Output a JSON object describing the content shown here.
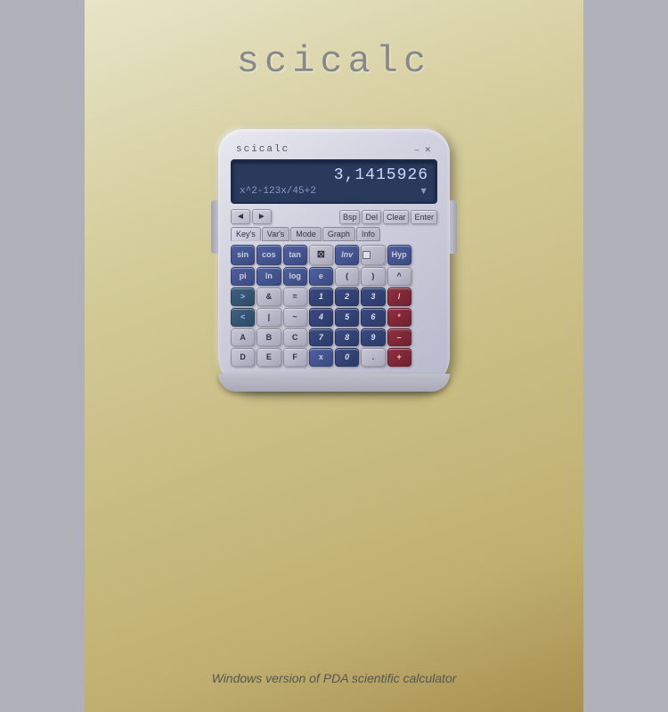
{
  "app": {
    "title": "scicalc",
    "subtitle": "Windows version of PDA scientific calculator"
  },
  "titlebar": {
    "label": "scicalc",
    "min_btn": "–",
    "close_btn": "✕"
  },
  "display": {
    "value": "3,1415926",
    "expression": "x^2-123x/45+2",
    "dropdown_arrow": "▼"
  },
  "controls": {
    "back_arrow": "◄",
    "fwd_arrow": "►",
    "bsp": "Bsp",
    "del": "Del",
    "clear": "Clear",
    "enter": "Enter"
  },
  "tabs": [
    {
      "label": "Key's",
      "active": true
    },
    {
      "label": "Var's",
      "active": false
    },
    {
      "label": "Mode",
      "active": false
    },
    {
      "label": "Graph",
      "active": false
    },
    {
      "label": "Info",
      "active": false
    }
  ],
  "rows": [
    [
      "sin",
      "cos",
      "tan",
      "✕",
      "Inv",
      "☐",
      "Hyp",
      ""
    ],
    [
      "pi",
      "ln",
      "log",
      "e",
      "(",
      ")",
      "^",
      ""
    ],
    [
      ">",
      "&",
      "=",
      "1",
      "2",
      "3",
      "/",
      ""
    ],
    [
      "<",
      "|",
      "~",
      "4",
      "5",
      "6",
      "*",
      ""
    ],
    [
      "A",
      "B",
      "C",
      "7",
      "8",
      "9",
      "–",
      ""
    ],
    [
      "D",
      "E",
      "F",
      "x",
      "0",
      ".",
      "+",
      ""
    ]
  ],
  "row_types": [
    [
      "btn-blue",
      "btn-blue",
      "btn-blue",
      "btn-gray",
      "btn-blue",
      "cb",
      "btn-blue",
      ""
    ],
    [
      "btn-blue",
      "btn-blue",
      "btn-blue",
      "btn-blue",
      "btn-gray",
      "btn-gray",
      "btn-gray",
      ""
    ],
    [
      "btn-green",
      "btn-gray",
      "btn-gray",
      "btn-number",
      "btn-number",
      "btn-number",
      "btn-op",
      ""
    ],
    [
      "btn-green",
      "btn-gray",
      "btn-gray",
      "btn-number",
      "btn-number",
      "btn-number",
      "btn-op",
      ""
    ],
    [
      "btn-gray",
      "btn-gray",
      "btn-gray",
      "btn-number",
      "btn-number",
      "btn-number",
      "btn-op",
      ""
    ],
    [
      "btn-gray",
      "btn-gray",
      "btn-gray",
      "btn-blue",
      "btn-number",
      "btn-gray",
      "btn-op",
      ""
    ]
  ]
}
